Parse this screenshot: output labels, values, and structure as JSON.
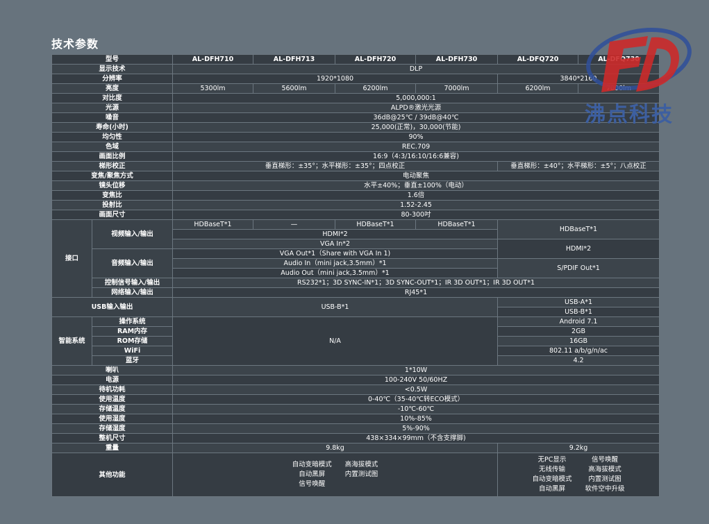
{
  "title": "技术参数",
  "watermark": {
    "text": "沸点科技",
    "letters": "FD",
    "color_red": "#cc2a2a",
    "color_blue": "#2f4f9a"
  },
  "models": [
    "AL-DFH710",
    "AL-DFH713",
    "AL-DFH720",
    "AL-DFH730",
    "AL-DFQ720",
    "AL-DFQ730"
  ],
  "labels": {
    "model": "型号",
    "display_tech": "显示技术",
    "resolution": "分辨率",
    "brightness": "亮度",
    "contrast": "对比度",
    "light_source": "光源",
    "noise": "噪音",
    "lifetime": "寿命(小时)",
    "uniformity": "均匀性",
    "gamut": "色域",
    "aspect": "画面比例",
    "keystone": "梯形校正",
    "zoom_focus": "变焦/聚焦方式",
    "lens_shift": "镜头位移",
    "zoom_ratio": "变焦比",
    "throw_ratio": "投射比",
    "screen_size": "画面尺寸",
    "interface": "接口",
    "video_io": "视频输入/输出",
    "audio_io": "音频输入/输出",
    "control_io": "控制信号输入/输出",
    "network_io": "网络输入/输出",
    "usb_io": "USB输入输出",
    "smart": "智能系统",
    "os": "操作系统",
    "ram": "RAM内存",
    "rom": "ROM存储",
    "wifi": "WiFi",
    "bluetooth": "蓝牙",
    "speaker": "喇叭",
    "power": "电源",
    "standby": "待机功耗",
    "op_temp": "使用温度",
    "storage_temp": "存储温度",
    "op_humidity": "使用湿度",
    "storage_humidity": "存储湿度",
    "dimensions": "整机尺寸",
    "weight": "重量",
    "other": "其他功能"
  },
  "values": {
    "display_tech": "DLP",
    "resolution_h": "1920*1080",
    "resolution_q": "3840*2160",
    "brightness": [
      "5300lm",
      "5600lm",
      "6200lm",
      "7000lm",
      "6200lm",
      "7000lm"
    ],
    "contrast": "5,000,000:1",
    "light_source": "ALPD®激光光源",
    "noise": "36dB@25℃ / 39dB@40℃",
    "lifetime": "25,000(正常)，30,000(节能)",
    "uniformity": "90%",
    "gamut": "REC.709",
    "aspect": "16:9（4:3/16:10/16:6兼容)",
    "keystone_h": "垂直梯形：±35°；水平梯形：±35°；四点校正",
    "keystone_q": "垂直梯形：±40°；水平梯形：±5°；八点校正",
    "zoom_focus": "电动聚焦",
    "lens_shift": "水平±40%；垂直±100%（电动）",
    "zoom_ratio": "1.6倍",
    "throw_ratio": "1.52-2.45",
    "screen_size": "80-300吋",
    "hdbaset": [
      "HDBaseT*1",
      "—",
      "HDBaseT*1",
      "HDBaseT*1"
    ],
    "hdbaset_q": "HDBaseT*1",
    "hdmi_h": "HDMI*2",
    "hdmi_q": "HDMI*2",
    "vga_in": "VGA In*2",
    "vga_out": "VGA Out*1（Share with VGA In 1)",
    "audio_in": "Audio In（mini jack,3.5mm）*1",
    "audio_out": "Audio Out（mini jack,3.5mm）*1",
    "spdif": "S/PDIF Out*1",
    "control": "RS232*1；3D SYNC-IN*1；3D SYNC-OUT*1；IR 3D OUT*1；IR 3D OUT*1",
    "network": "RJ45*1",
    "usb_h": "USB-B*1",
    "usb_q_a": "USB-A*1",
    "usb_q_b": "USB-B*1",
    "smart_h": "N/A",
    "os": "Android 7.1",
    "ram": "2GB",
    "rom": "16GB",
    "wifi": "802.11 a/b/g/n/ac",
    "bluetooth": "4.2",
    "speaker": "1*10W",
    "power": "100-240V 50/60HZ",
    "standby": "<0.5W",
    "op_temp": "0-40℃（35-40℃转ECO模式）",
    "storage_temp": "-10℃-60℃",
    "op_humidity": "10%-85%",
    "storage_humidity": "5%-90%",
    "dimensions": "438×334×99mm（不含支撑脚)",
    "weight_h": "9.8kg",
    "weight_q": "9.2kg",
    "other_h_col1": [
      "自动变暗模式",
      "自动黑屏",
      "信号唤醒"
    ],
    "other_h_col2": [
      "高海拔模式",
      "内置测试图"
    ],
    "other_q_col1": [
      "无PC显示",
      "无线传输",
      "自动变暗模式",
      "自动黑屏"
    ],
    "other_q_col2": [
      "信号唤醒",
      "高海拔模式",
      "内置测试图",
      "软件空中升级"
    ]
  }
}
